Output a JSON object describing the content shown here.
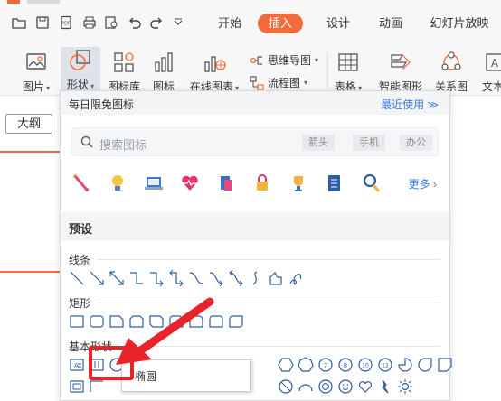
{
  "menu": {
    "tabs": [
      {
        "label": "开始",
        "active": false
      },
      {
        "label": "插入",
        "active": true
      },
      {
        "label": "设计",
        "active": false
      },
      {
        "label": "动画",
        "active": false
      },
      {
        "label": "幻灯片放映",
        "active": false
      }
    ]
  },
  "ribbon": {
    "picture": "图片",
    "shape": "形状",
    "icon_lib": "图标库",
    "icon": "图标",
    "online_chart": "在线图表",
    "mindmap": "思维导图",
    "flowchart": "流程图",
    "table": "表格",
    "smart_shape": "智能图形",
    "relation": "关系图",
    "text": "文本"
  },
  "left": {
    "outline_tab": "大纲"
  },
  "panel": {
    "title": "每日限免图标",
    "recent": "最近使用",
    "search_placeholder": "搜索图标",
    "chips": [
      "箭头",
      "手机",
      "办公"
    ],
    "more": "更多",
    "preset": "预设",
    "sections": {
      "lines": "线条",
      "rect": "矩形",
      "basic": "基本形状"
    },
    "tooltip": "椭圆",
    "free_icons": [
      "firework-icon",
      "bulb-icon",
      "laptop-chart-icon",
      "heart-pulse-icon",
      "books-icon",
      "lock-icon",
      "trophy-icon",
      "document-icon",
      "magnifier-icon"
    ]
  },
  "colors": {
    "accent": "#f26b3a",
    "link": "#3b7ddd",
    "highlight": "#e8232b",
    "shape_stroke": "#2f5d9e"
  }
}
